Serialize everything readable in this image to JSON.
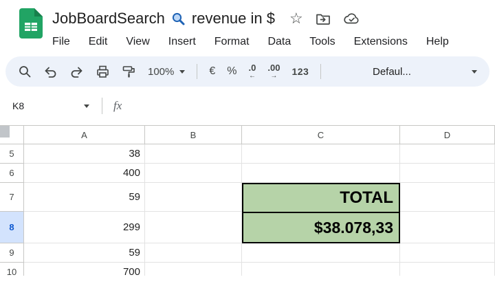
{
  "header": {
    "doc_title_part1": "JobBoardSearch",
    "doc_title_part2": "revenue in $",
    "menu_items": [
      "File",
      "Edit",
      "View",
      "Insert",
      "Format",
      "Data",
      "Tools",
      "Extensions",
      "Help"
    ]
  },
  "toolbar": {
    "zoom_value": "100%",
    "currency_label": "€",
    "percent_label": "%",
    "decrease_decimal_label": ".0",
    "decrease_decimal_arrow": "←",
    "increase_decimal_label": ".00",
    "increase_decimal_arrow": "→",
    "more_formats_label": "123",
    "font_selector_value": "Defaul..."
  },
  "formula_bar": {
    "cell_reference": "K8",
    "fx_label": "fx"
  },
  "grid": {
    "column_headers": [
      "A",
      "B",
      "C",
      "D"
    ],
    "rows": [
      {
        "number": "5",
        "col_a": "38",
        "col_c": ""
      },
      {
        "number": "6",
        "col_a": "400",
        "col_c": ""
      },
      {
        "number": "7",
        "col_a": "59",
        "col_c": "TOTAL"
      },
      {
        "number": "8",
        "col_a": "299",
        "col_c": "$38.078,33"
      },
      {
        "number": "9",
        "col_a": "59",
        "col_c": ""
      },
      {
        "number": "10",
        "col_a": "700",
        "col_c": ""
      }
    ]
  },
  "colors": {
    "green_cell_bg": "#b6d3a8",
    "selected_row_bg": "#d3e3fd",
    "selected_row_text": "#0b57d0",
    "toolbar_bg": "#edf2fa",
    "sheets_green": "#21a464"
  }
}
